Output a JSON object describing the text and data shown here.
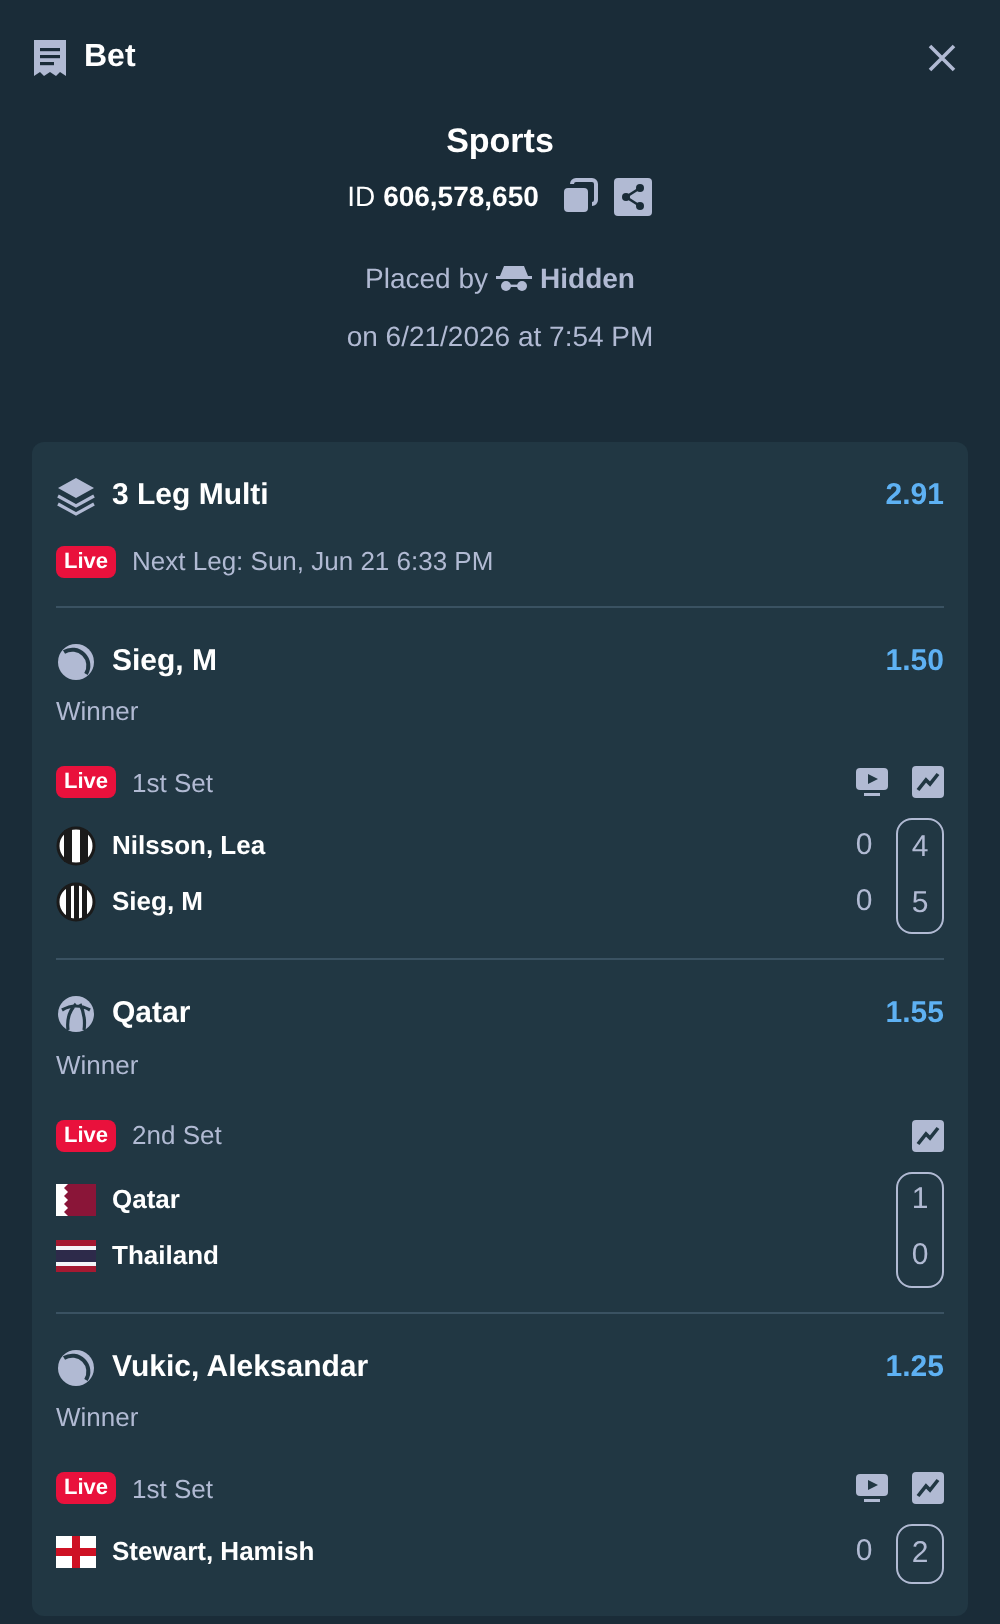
{
  "header": {
    "title": "Bet"
  },
  "summary": {
    "title": "Sports",
    "id_label": "ID",
    "id_value": "606,578,650",
    "placed_by": "Placed by",
    "user": "Hidden",
    "placed_on": "on 6/21/2026 at 7:54 PM"
  },
  "multi": {
    "title": "3 Leg Multi",
    "odds": "2.91",
    "badge": "Live",
    "next_leg": "Next Leg: Sun, Jun 21 6:33 PM"
  },
  "legs": [
    {
      "kind": "tennis",
      "selection": "Sieg, M",
      "odds": "1.50",
      "market": "Winner",
      "badge": "Live",
      "period": "1st Set",
      "stream": true,
      "competitors": [
        {
          "name": "Nilsson, Lea",
          "kind": "stripes-2"
        },
        {
          "name": "Sieg, M",
          "kind": "stripes-3"
        }
      ],
      "sets": [
        {
          "current": false,
          "scores": [
            "0",
            "0"
          ]
        },
        {
          "current": true,
          "scores": [
            "4",
            "5"
          ]
        }
      ]
    },
    {
      "kind": "volleyball",
      "selection": "Qatar",
      "odds": "1.55",
      "market": "Winner",
      "badge": "Live",
      "period": "2nd Set",
      "stream": false,
      "competitors": [
        {
          "name": "Qatar",
          "kind": "qatar"
        },
        {
          "name": "Thailand",
          "kind": "thailand"
        }
      ],
      "sets": [
        {
          "current": true,
          "scores": [
            "1",
            "0"
          ]
        }
      ]
    },
    {
      "kind": "tennis",
      "selection": "Vukic, Aleksandar",
      "odds": "1.25",
      "market": "Winner",
      "badge": "Live",
      "period": "1st Set",
      "stream": true,
      "competitors": [
        {
          "name": "Stewart, Hamish",
          "kind": "england"
        }
      ],
      "sets": [
        {
          "current": false,
          "scores": [
            "0"
          ]
        },
        {
          "current": true,
          "scores": [
            "2"
          ]
        }
      ]
    }
  ]
}
